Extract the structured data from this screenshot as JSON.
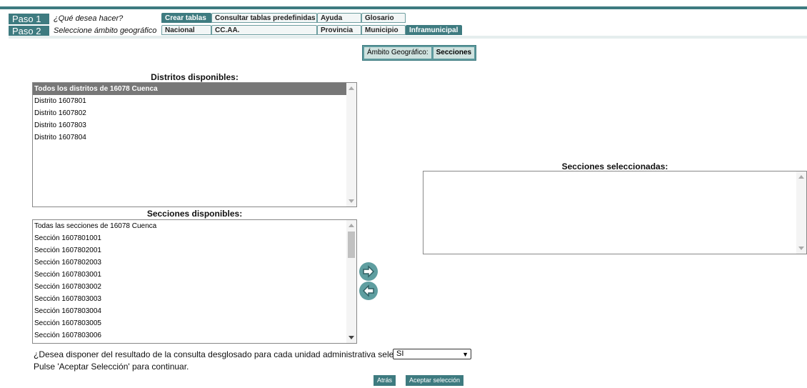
{
  "steps": [
    {
      "label": "Paso 1",
      "text": "¿Qué desea hacer?"
    },
    {
      "label": "Paso 2",
      "text": "Seleccione ámbito geográfico"
    }
  ],
  "tabs_row1": [
    "Crear tablas",
    "Consultar tablas predefinidas",
    "Ayuda",
    "Glosario"
  ],
  "tabs_row2": [
    "Nacional",
    "CC.AA.",
    "Provincia",
    "Municipio",
    "Inframunicipal"
  ],
  "ambito": {
    "label": "Ámbito Geográfico:",
    "value": "Secciones"
  },
  "distritos": {
    "heading": "Distritos disponibles:",
    "items": [
      "Todos los distritos de 16078 Cuenca",
      "Distrito 1607801",
      "Distrito 1607802",
      "Distrito 1607803",
      "Distrito 1607804"
    ]
  },
  "secciones": {
    "heading": "Secciones disponibles:",
    "items": [
      "Todas las secciones de 16078 Cuenca",
      "Sección 1607801001",
      "Sección 1607802001",
      "Sección 1607802003",
      "Sección 1607803001",
      "Sección 1607803002",
      "Sección 1607803003",
      "Sección 1607803004",
      "Sección 1607803005",
      "Sección 1607803006"
    ]
  },
  "seleccionadas": {
    "heading": "Secciones seleccionadas:"
  },
  "arrows": {
    "add": "arrow-right-icon",
    "remove": "arrow-left-icon"
  },
  "question": "¿Desea disponer del resultado de la consulta desglosado para cada unidad administrativa seleccionada?",
  "select_value": "SI",
  "hint": "Pulse 'Aceptar Selección' para continuar.",
  "buttons": {
    "back": "Atrás",
    "accept": "Aceptar selección"
  },
  "colors": {
    "accent": "#3e7b80",
    "selected_row": "#777777",
    "arrow_button": "#5f9ea0"
  }
}
